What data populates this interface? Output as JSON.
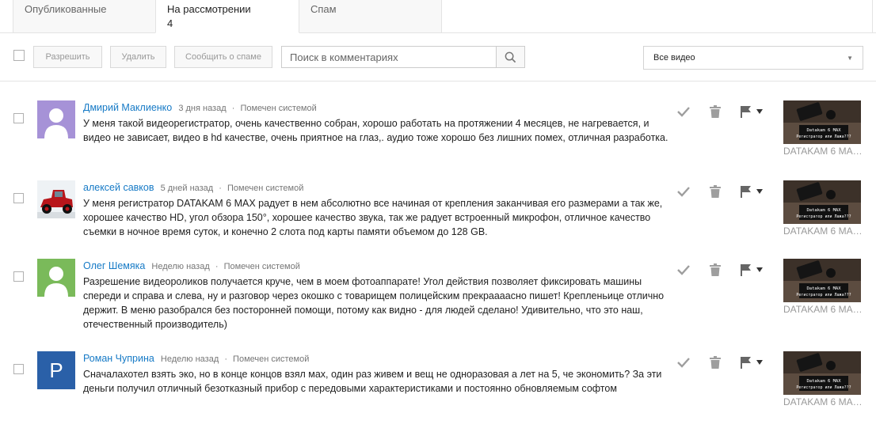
{
  "tabs": [
    {
      "label": "Опубликованные"
    },
    {
      "label": "На рассмотрении",
      "count": "4"
    },
    {
      "label": "Спам"
    }
  ],
  "toolbar": {
    "approve_label": "Разрешить",
    "delete_label": "Удалить",
    "report_spam_label": "Сообщить о спаме",
    "search_placeholder": "Поиск в комментариях",
    "video_filter": "Все видео"
  },
  "comments": [
    {
      "author": "Дмирий Маклиенко",
      "time": "3 дня назад",
      "status": "Помечен системой",
      "avatar": "default-purple",
      "text": "У меня такой видеорегистратор, очень качественно собран, хорошо работать на протяжении 4 месяцев, не нагревается, и видео не зависает, видео в hd качестве, очень приятное на глаз,. аудио тоже хорошо без лишних помех, отличная разработка.",
      "video_title": "DATAKAM 6 MAX - Регистратор или Лажа???",
      "thumb_caption": [
        "Datakam 6 MAX",
        "Регистратор или Лажа???"
      ]
    },
    {
      "author": "алексей савков",
      "time": "5 дней назад",
      "status": "Помечен системой",
      "avatar": "red-car",
      "text": "У меня регистратор DATAKAM 6 MAX  радует в нем абсолютно все начиная от крепления заканчивая его размерами а так же, хорошее качество HD, угол обзора 150°, хорошее качество  звука, так же радует встроенный микрофон, отличное качество съемки в ночное время суток, и конечно 2 слота под карты памяти объемом до 128 GB.",
      "video_title": "DATAKAM 6 MAX - Регистратор или Лажа???",
      "thumb_caption": [
        "Datakam 6 MAX",
        "Регистратор или Лажа???"
      ]
    },
    {
      "author": "Олег Шемяка",
      "time": "Неделю назад",
      "status": "Помечен системой",
      "avatar": "default-green",
      "text": "Разрешение видеороликов получается круче, чем в моем фотоаппарате! Угол действия позволяет фиксировать машины спереди и справа и слева, ну и разговор через окошко с товарищем полицейским прекраааасно пишет! Крепленьице отлично держит. В меню разобрался без посторонней помощи, потому как видно - для людей сделано! Удивительно, что это наш, отечественный производитель)",
      "video_title": "DATAKAM 6 MAX - Регистратор или Лажа???",
      "thumb_caption": [
        "Datakam 6 MAX",
        "Регистратор или Лажа???"
      ]
    },
    {
      "author": "Роман Чуприна",
      "time": "Неделю назад",
      "status": "Помечен системой",
      "avatar": "letter",
      "avatar_letter": "P",
      "text": "Сначалахотел взять эко, но в конце концов взял мах, один раз живем и вещ не одноразовая а лет на 5, че экономить? За эти деньги получил отличный безотказный прибор с передовыми характеристиками и постоянно обновляемым софтом",
      "video_title": "DATAKAM 6 MAX - Регистратор или Лажа???",
      "thumb_caption": [
        "Datakam 6 MAX",
        "Регистратор или Лажа???"
      ]
    }
  ],
  "colors": {
    "author": "#167ac6",
    "avatar_purple": "#a692d7",
    "avatar_green": "#7aba5a",
    "avatar_blue": "#2a60a8"
  }
}
